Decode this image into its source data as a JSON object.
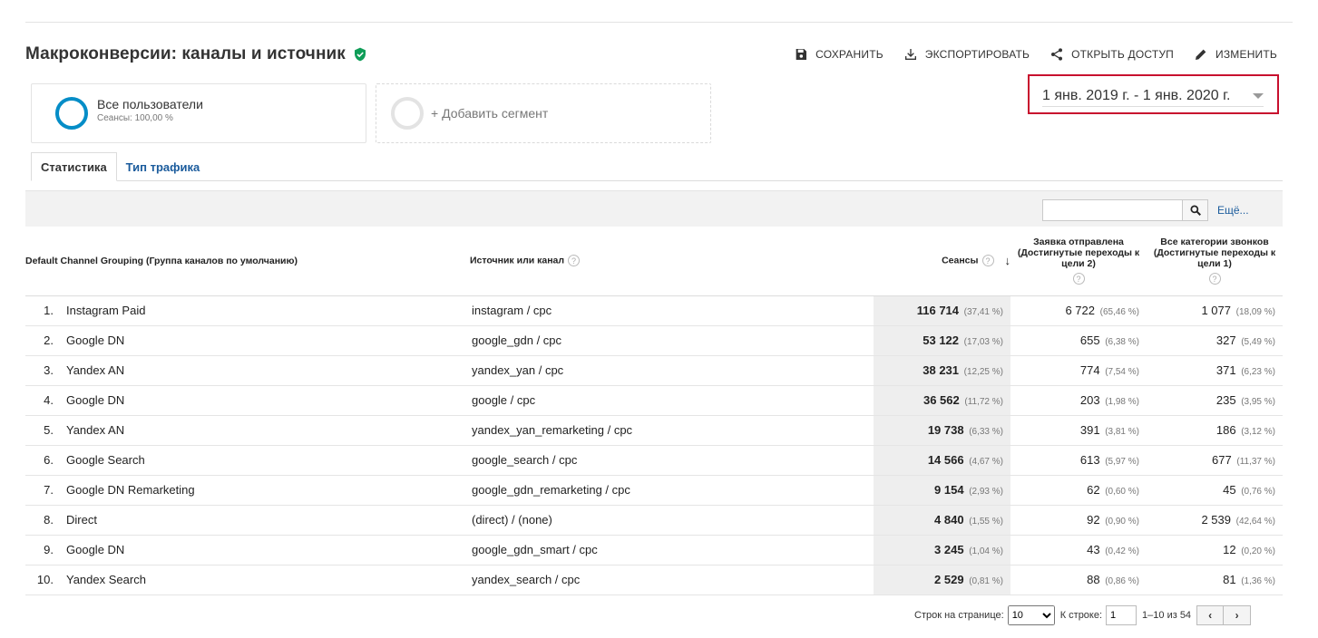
{
  "header": {
    "title": "Макроконверсии: каналы и источник",
    "actions": {
      "save": "СОХРАНИТЬ",
      "export": "ЭКСПОРТИРОВАТЬ",
      "share": "ОТКРЫТЬ ДОСТУП",
      "edit": "ИЗМЕНИТЬ"
    }
  },
  "segments": {
    "active_name": "Все пользователи",
    "active_sub": "Сеансы: 100,00 %",
    "add_label": "+ Добавить сегмент"
  },
  "date_range": "1 янв. 2019 г. - 1 янв. 2020 г.",
  "tabs": [
    "Статистика",
    "Тип трафика"
  ],
  "toolbar": {
    "search_value": "",
    "more": "Ещё..."
  },
  "table": {
    "headers": {
      "channel": "Default Channel Grouping (Группа каналов по умолчанию)",
      "source": "Источник или канал",
      "sessions": "Сеансы",
      "goal2": "Заявка отправлена (Достигнутые переходы к цели 2)",
      "goal1": "Все категории звонков (Достигнутые переходы к цели 1)"
    },
    "help_glyph": "?",
    "rows": [
      {
        "idx": "1.",
        "channel": "Instagram Paid",
        "source": "instagram / cpc",
        "sessions": "116 714",
        "sessions_pct": "(37,41 %)",
        "g2": "6 722",
        "g2_pct": "(65,46 %)",
        "g1": "1 077",
        "g1_pct": "(18,09 %)"
      },
      {
        "idx": "2.",
        "channel": "Google DN",
        "source": "google_gdn / cpc",
        "sessions": "53 122",
        "sessions_pct": "(17,03 %)",
        "g2": "655",
        "g2_pct": "(6,38 %)",
        "g1": "327",
        "g1_pct": "(5,49 %)"
      },
      {
        "idx": "3.",
        "channel": "Yandex AN",
        "source": "yandex_yan / cpc",
        "sessions": "38 231",
        "sessions_pct": "(12,25 %)",
        "g2": "774",
        "g2_pct": "(7,54 %)",
        "g1": "371",
        "g1_pct": "(6,23 %)"
      },
      {
        "idx": "4.",
        "channel": "Google DN",
        "source": "google / cpc",
        "sessions": "36 562",
        "sessions_pct": "(11,72 %)",
        "g2": "203",
        "g2_pct": "(1,98 %)",
        "g1": "235",
        "g1_pct": "(3,95 %)"
      },
      {
        "idx": "5.",
        "channel": "Yandex AN",
        "source": "yandex_yan_remarketing / cpc",
        "sessions": "19 738",
        "sessions_pct": "(6,33 %)",
        "g2": "391",
        "g2_pct": "(3,81 %)",
        "g1": "186",
        "g1_pct": "(3,12 %)"
      },
      {
        "idx": "6.",
        "channel": "Google Search",
        "source": "google_search / cpc",
        "sessions": "14 566",
        "sessions_pct": "(4,67 %)",
        "g2": "613",
        "g2_pct": "(5,97 %)",
        "g1": "677",
        "g1_pct": "(11,37 %)"
      },
      {
        "idx": "7.",
        "channel": "Google DN Remarketing",
        "source": "google_gdn_remarketing / cpc",
        "sessions": "9 154",
        "sessions_pct": "(2,93 %)",
        "g2": "62",
        "g2_pct": "(0,60 %)",
        "g1": "45",
        "g1_pct": "(0,76 %)"
      },
      {
        "idx": "8.",
        "channel": "Direct",
        "source": "(direct) / (none)",
        "sessions": "4 840",
        "sessions_pct": "(1,55 %)",
        "g2": "92",
        "g2_pct": "(0,90 %)",
        "g1": "2 539",
        "g1_pct": "(42,64 %)"
      },
      {
        "idx": "9.",
        "channel": "Google DN",
        "source": "google_gdn_smart / cpc",
        "sessions": "3 245",
        "sessions_pct": "(1,04 %)",
        "g2": "43",
        "g2_pct": "(0,42 %)",
        "g1": "12",
        "g1_pct": "(0,20 %)"
      },
      {
        "idx": "10.",
        "channel": "Yandex Search",
        "source": "yandex_search / cpc",
        "sessions": "2 529",
        "sessions_pct": "(0,81 %)",
        "g2": "88",
        "g2_pct": "(0,86 %)",
        "g1": "81",
        "g1_pct": "(1,36 %)"
      }
    ]
  },
  "pagination": {
    "rows_label": "Строк на странице:",
    "rows_value": "10",
    "goto_label": "К строке:",
    "goto_value": "1",
    "range": "1–10 из 54",
    "prev": "‹",
    "next": "›"
  },
  "colors": {
    "verified": "#0f9d58",
    "segment_ring": "#058dc7",
    "date_highlight": "#c8102e",
    "link": "#1a5b9c"
  },
  "icons": [
    "verified-check-icon",
    "save-icon",
    "download-icon",
    "share-icon",
    "pencil-icon",
    "search-icon"
  ]
}
